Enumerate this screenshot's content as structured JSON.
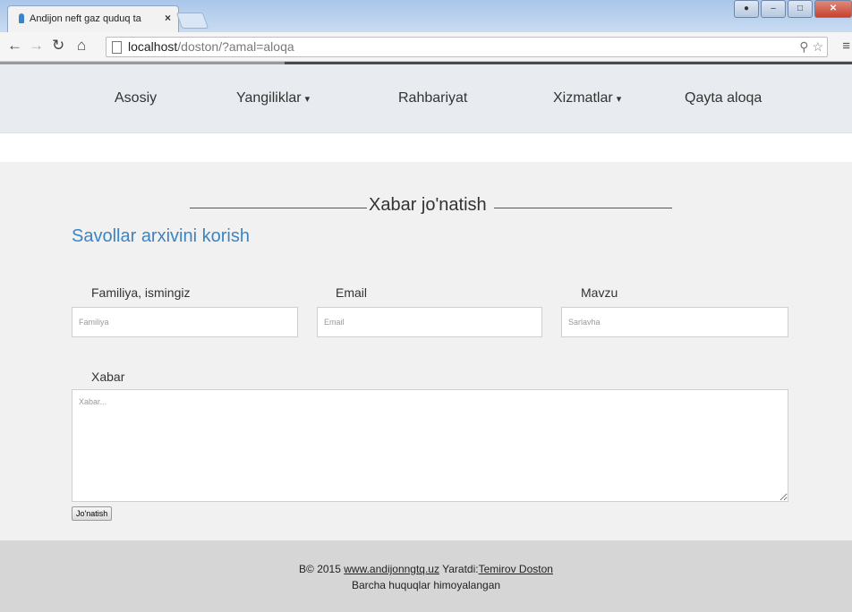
{
  "browser": {
    "tab_title": "Andijon neft gaz quduq ta",
    "tab_close": "×",
    "url_host": "localhost",
    "url_path": "/doston/?amal=aloqa"
  },
  "nav": {
    "items": [
      {
        "label": "Asosiy",
        "dropdown": false
      },
      {
        "label": "Yangiliklar",
        "dropdown": true
      },
      {
        "label": "Rahbariyat",
        "dropdown": false
      },
      {
        "label": "Xizmatlar",
        "dropdown": true
      },
      {
        "label": "Qayta aloqa",
        "dropdown": false
      }
    ]
  },
  "form": {
    "title": "Xabar jo'natish",
    "archive_link": "Savollar arxivini korish",
    "name_label": "Familiya, ismingiz",
    "name_placeholder": "Familiya",
    "email_label": "Email",
    "email_placeholder": "Email",
    "subject_label": "Mavzu",
    "subject_placeholder": "Sarlavha",
    "message_label": "Xabar",
    "message_placeholder": "Xabar...",
    "submit_label": "Jo'natish"
  },
  "footer": {
    "copyright_prefix": "B© 2015",
    "site_link": "www.andijonngtq.uz",
    "author_prefix": "Yaratdi:",
    "author_link": "Temirov Doston",
    "rights": "Barcha huquqlar himoyalangan"
  }
}
